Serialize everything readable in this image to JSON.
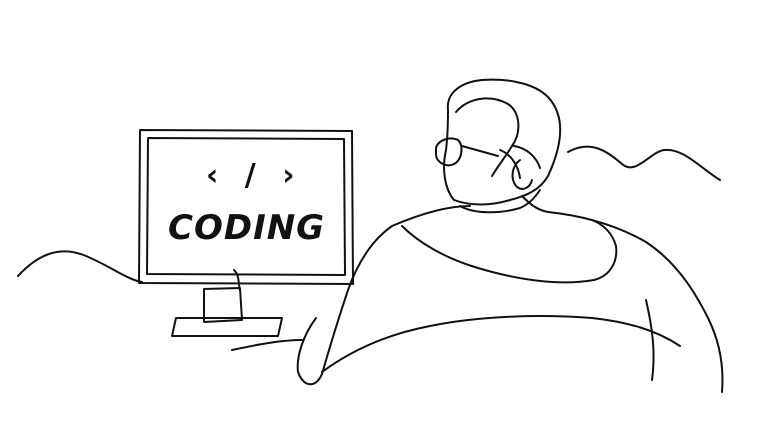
{
  "screen": {
    "symbol": "‹ / ›",
    "label": "CODING"
  },
  "colors": {
    "line": "#111111",
    "background": "#ffffff"
  }
}
